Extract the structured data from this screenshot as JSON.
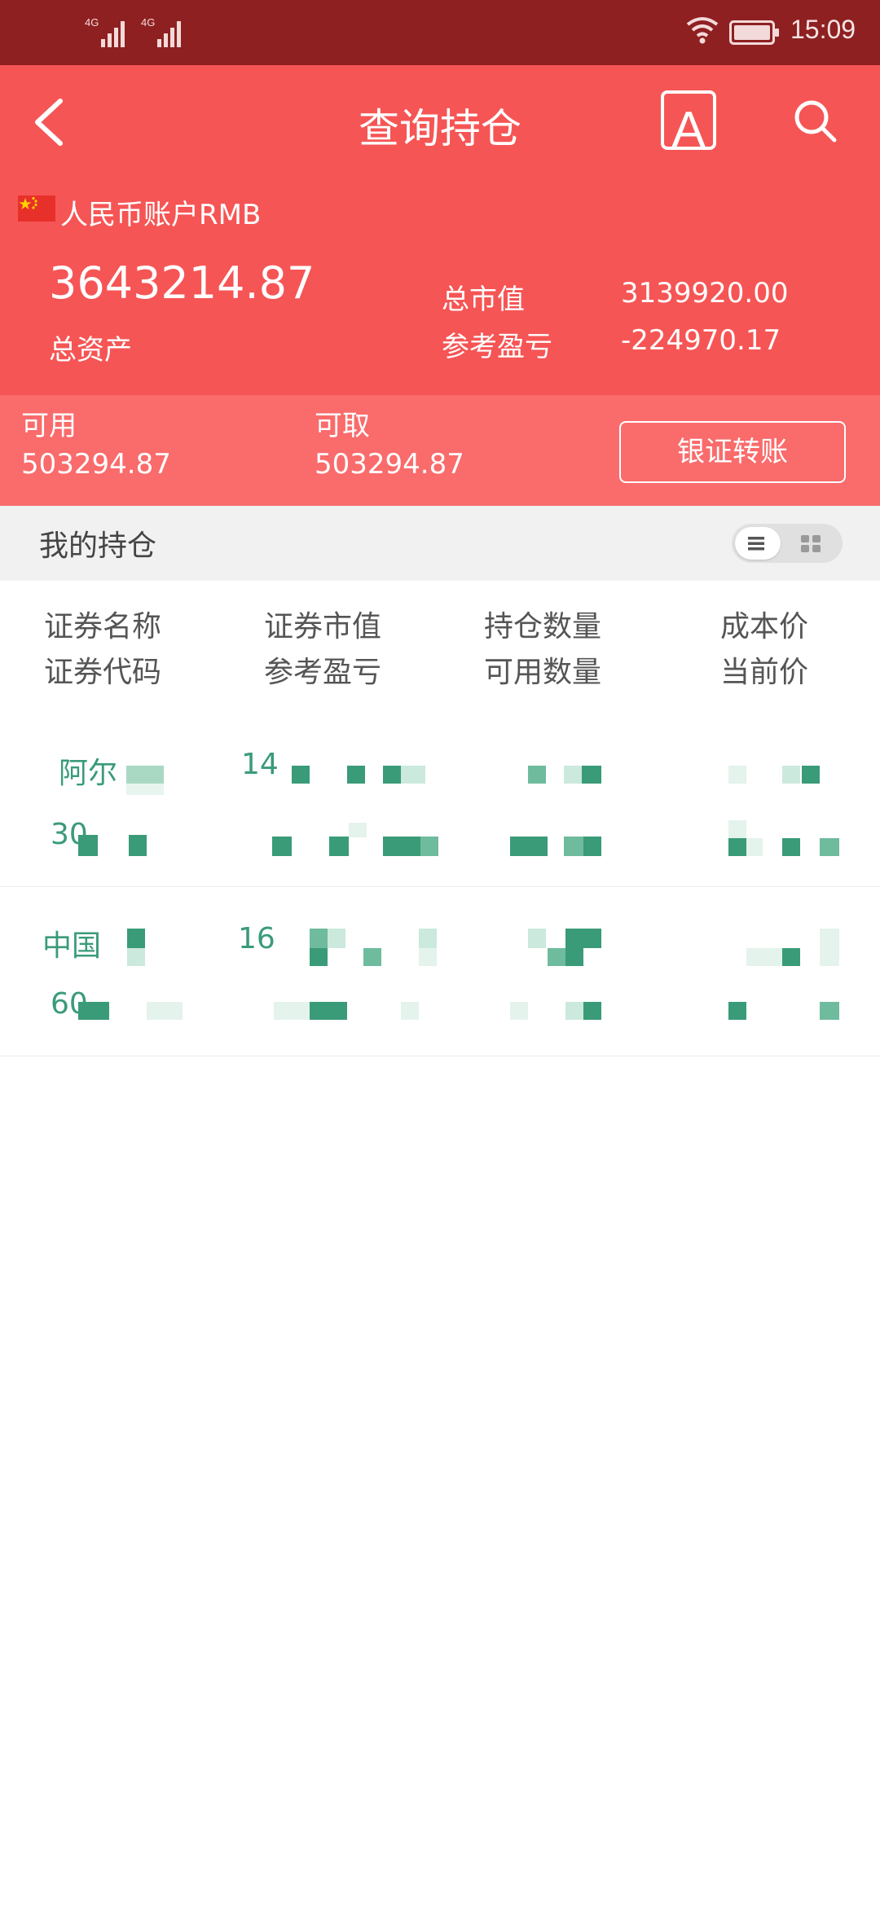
{
  "status_bar": {
    "sim1_network": "4G",
    "sim2_network": "4G",
    "time": "15:09"
  },
  "header": {
    "title": "查询持仓",
    "font_button_glyph": "A",
    "account_label": "人民币账户RMB",
    "total_assets_value": "3643214.87",
    "total_assets_label": "总资产",
    "market_value_label": "总市值",
    "market_value": "3139920.00",
    "profit_label": "参考盈亏",
    "profit_value": "-224970.17"
  },
  "funds": {
    "available_label": "可用",
    "available_value": "503294.87",
    "withdrawable_label": "可取",
    "withdrawable_value": "503294.87",
    "transfer_button": "银证转账"
  },
  "holdings": {
    "section_title": "我的持仓",
    "columns": [
      {
        "top": "证券名称",
        "bottom": "证券代码"
      },
      {
        "top": "证券市值",
        "bottom": "参考盈亏"
      },
      {
        "top": "持仓数量",
        "bottom": "可用数量"
      },
      {
        "top": "成本价",
        "bottom": "当前价"
      }
    ],
    "rows": [
      {
        "name_visible": "阿尔",
        "code_visible": "30",
        "value_visible": "14"
      },
      {
        "name_visible": "中国",
        "code_visible": "60",
        "value_visible": "16"
      }
    ]
  },
  "icons": {
    "back": "chevron-left-icon",
    "font": "font-size-icon",
    "search": "search-icon",
    "flag": "china-flag-icon",
    "list_view": "list-view-icon",
    "grid_view": "grid-view-icon"
  },
  "colors": {
    "status_bar": "#8e2021",
    "header": "#f65555",
    "funds_strip": "#fa6b6b",
    "holding_text": "#3a9b78"
  }
}
